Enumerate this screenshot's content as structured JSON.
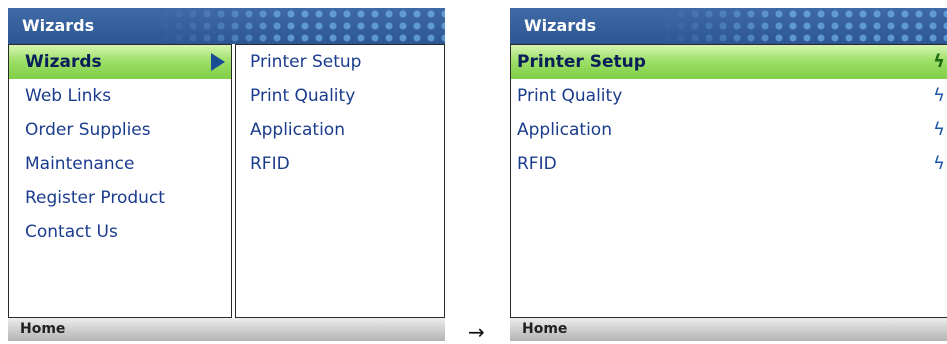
{
  "left_screen": {
    "title": "Wizards",
    "menu": [
      {
        "label": "Wizards",
        "selected": true
      },
      {
        "label": "Web Links"
      },
      {
        "label": "Order Supplies"
      },
      {
        "label": "Maintenance"
      },
      {
        "label": "Register Product"
      },
      {
        "label": "Contact Us"
      }
    ],
    "submenu": [
      "Printer Setup",
      "Print Quality",
      "Application",
      "RFID"
    ],
    "status": "Home"
  },
  "transition_arrow": "→",
  "right_screen": {
    "title": "Wizards",
    "menu": [
      {
        "label": "Printer Setup",
        "selected": true
      },
      {
        "label": "Print Quality"
      },
      {
        "label": "Application"
      },
      {
        "label": "RFID"
      }
    ],
    "item_icon": "lightning-bolt-icon",
    "status": "Home"
  },
  "colors": {
    "title_bar": "#2d5793",
    "menu_text": "#1a3c8c",
    "selection_green": "#8fd85a",
    "status_bar": "#c8c8c8"
  }
}
